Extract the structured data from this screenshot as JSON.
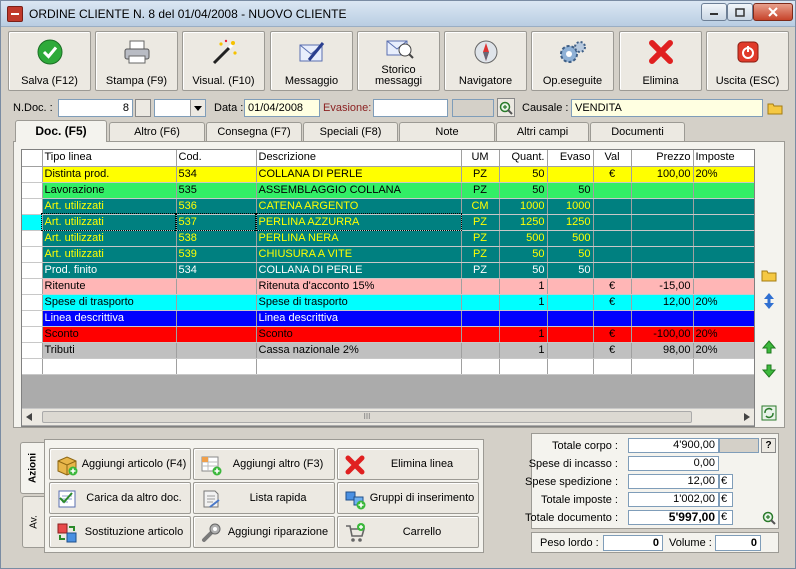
{
  "window": {
    "title": "ORDINE CLIENTE N. 8  del 01/04/2008 - NUOVO CLIENTE"
  },
  "toolbar": [
    {
      "label": "Salva (F12)",
      "icon": "check-circle-icon"
    },
    {
      "label": "Stampa (F9)",
      "icon": "printer-icon"
    },
    {
      "label": "Visual. (F10)",
      "icon": "magic-wand-icon"
    },
    {
      "label": "Messaggio",
      "icon": "message-pen-icon"
    },
    {
      "label": "Storico\nmessaggi",
      "icon": "message-history-icon"
    },
    {
      "label": "Navigatore",
      "icon": "compass-icon"
    },
    {
      "label": "Op.eseguite",
      "icon": "gears-icon"
    },
    {
      "label": "Elimina",
      "icon": "red-x-icon"
    },
    {
      "label": "Uscita (ESC)",
      "icon": "exit-power-icon"
    }
  ],
  "header": {
    "ndoc_label": "N.Doc. :",
    "ndoc_value": "8",
    "data_label": "Data :",
    "data_value": "01/04/2008",
    "evasione_label": "Evasione:",
    "evasione_value": "",
    "causale_label": "Causale :",
    "causale_value": "VENDITA"
  },
  "tabs": [
    "Doc. (F5)",
    "Altro (F6)",
    "Consegna (F7)",
    "Speciali (F8)",
    "Note",
    "Altri campi",
    "Documenti"
  ],
  "grid": {
    "columns": [
      "Tipo linea",
      "Cod.",
      "Descrizione",
      "UM",
      "Quant.",
      "Evaso",
      "Val",
      "Prezzo",
      "Imposte"
    ],
    "rows": [
      {
        "tipo": "Distinta prod.",
        "cod": "534",
        "desc": "COLLANA DI PERLE",
        "um": "PZ",
        "quant": "50",
        "evaso": "",
        "val": "€",
        "prezzo": "100,00",
        "imposte": "20%",
        "bg": "#ffff00",
        "fg": "#000000"
      },
      {
        "tipo": "Lavorazione",
        "cod": "535",
        "desc": "ASSEMBLAGGIO COLLANA",
        "um": "PZ",
        "quant": "50",
        "evaso": "50",
        "val": "",
        "prezzo": "",
        "imposte": "",
        "bg": "#33ee66",
        "fg": "#000000"
      },
      {
        "tipo": "Art. utilizzati",
        "cod": "536",
        "desc": "CATENA ARGENTO",
        "um": "CM",
        "quant": "1000",
        "evaso": "1000",
        "val": "",
        "prezzo": "",
        "imposte": "",
        "bg": "#008080",
        "fg": "#ffff00"
      },
      {
        "tipo": "Art. utilizzati",
        "cod": "537",
        "desc": "PERLINA AZZURRA",
        "um": "PZ",
        "quant": "1250",
        "evaso": "1250",
        "val": "",
        "prezzo": "",
        "imposte": "",
        "bg": "#008080",
        "fg": "#ffff00"
      },
      {
        "tipo": "Art. utilizzati",
        "cod": "538",
        "desc": "PERLINA NERA",
        "um": "PZ",
        "quant": "500",
        "evaso": "500",
        "val": "",
        "prezzo": "",
        "imposte": "",
        "bg": "#008080",
        "fg": "#ffff00"
      },
      {
        "tipo": "Art. utilizzati",
        "cod": "539",
        "desc": "CHIUSURA A VITE",
        "um": "PZ",
        "quant": "50",
        "evaso": "50",
        "val": "",
        "prezzo": "",
        "imposte": "",
        "bg": "#008080",
        "fg": "#ffff00"
      },
      {
        "tipo": "Prod. finito",
        "cod": "534",
        "desc": "COLLANA DI PERLE",
        "um": "PZ",
        "quant": "50",
        "evaso": "50",
        "val": "",
        "prezzo": "",
        "imposte": "",
        "bg": "#008080",
        "fg": "#ffffff"
      },
      {
        "tipo": "Ritenute",
        "cod": "",
        "desc": "Ritenuta d'acconto 15%",
        "um": "",
        "quant": "1",
        "evaso": "",
        "val": "€",
        "prezzo": "-15,00",
        "imposte": "",
        "bg": "#ffb6b6",
        "fg": "#000000"
      },
      {
        "tipo": "Spese di trasporto",
        "cod": "",
        "desc": "Spese di trasporto",
        "um": "",
        "quant": "1",
        "evaso": "",
        "val": "€",
        "prezzo": "12,00",
        "imposte": "20%",
        "bg": "#00ffff",
        "fg": "#000000"
      },
      {
        "tipo": "Linea descrittiva",
        "cod": "",
        "desc": "Linea descrittiva",
        "um": "",
        "quant": "",
        "evaso": "",
        "val": "",
        "prezzo": "",
        "imposte": "",
        "bg": "#0000ff",
        "fg": "#ffffff"
      },
      {
        "tipo": "Sconto",
        "cod": "",
        "desc": "Sconto",
        "um": "",
        "quant": "1",
        "evaso": "",
        "val": "€",
        "prezzo": "-100,00",
        "imposte": "20%",
        "bg": "#ff0000",
        "fg": "#000000"
      },
      {
        "tipo": "Tributi",
        "cod": "",
        "desc": "Cassa nazionale 2%",
        "um": "",
        "quant": "1",
        "evaso": "",
        "val": "€",
        "prezzo": "98,00",
        "imposte": "20%",
        "bg": "#c0c0c0",
        "fg": "#000000"
      },
      {
        "tipo": "",
        "cod": "",
        "desc": "",
        "um": "",
        "quant": "",
        "evaso": "",
        "val": "",
        "prezzo": "",
        "imposte": "",
        "bg": "#ffffff",
        "fg": "#000000"
      }
    ],
    "scroll_thumb_label": "III"
  },
  "side_tabs": {
    "azioni": "Azioni",
    "av": "Av."
  },
  "actions": [
    {
      "label": "Aggiungi articolo (F4)",
      "icon": "add-article-icon"
    },
    {
      "label": "Aggiungi altro (F3)",
      "icon": "add-other-icon"
    },
    {
      "label": "Elimina linea",
      "icon": "delete-line-icon"
    },
    {
      "label": "Carica da altro doc.",
      "icon": "load-from-doc-icon"
    },
    {
      "label": "Lista rapida",
      "icon": "quick-list-icon"
    },
    {
      "label": "Gruppi di inserimento",
      "icon": "insert-groups-icon"
    },
    {
      "label": "Sostituzione articolo",
      "icon": "replace-article-icon"
    },
    {
      "label": "Aggiungi riparazione",
      "icon": "add-repair-icon"
    },
    {
      "label": "Carrello",
      "icon": "cart-icon"
    }
  ],
  "totals": {
    "corpo_label": "Totale corpo :",
    "corpo_value": "4'900,00",
    "incasso_label": "Spese di incasso :",
    "incasso_value": "0,00",
    "spedizione_label": "Spese spedizione :",
    "spedizione_value": "12,00",
    "spedizione_cur": "€",
    "imposte_label": "Totale imposte :",
    "imposte_value": "1'002,00",
    "imposte_cur": "€",
    "documento_label": "Totale documento :",
    "documento_value": "5'997,00",
    "documento_cur": "€",
    "help_label": "?"
  },
  "weights": {
    "peso_label": "Peso lordo :",
    "peso_value": "0",
    "volume_label": "Volume :",
    "volume_value": "0"
  }
}
